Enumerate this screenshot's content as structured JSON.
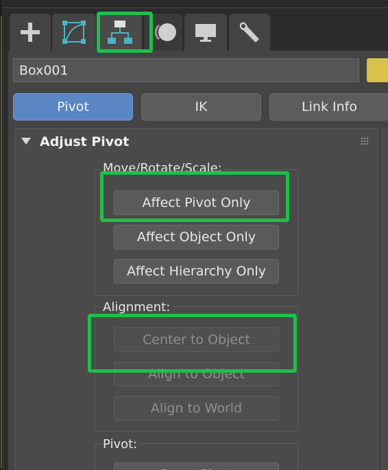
{
  "command_panel": {
    "tabs": [
      {
        "name": "create-tab",
        "icon": "plus-icon"
      },
      {
        "name": "modify-tab",
        "icon": "curve-modify-icon"
      },
      {
        "name": "hierarchy-tab",
        "icon": "hierarchy-icon",
        "active": true
      },
      {
        "name": "motion-tab",
        "icon": "motion-circle-icon"
      },
      {
        "name": "display-tab",
        "icon": "monitor-icon"
      },
      {
        "name": "utilities-tab",
        "icon": "wrench-icon"
      }
    ],
    "object_name": "Box001",
    "object_color": "#d9c14a"
  },
  "mode_buttons": {
    "pivot": "Pivot",
    "ik": "IK",
    "link_info": "Link Info"
  },
  "rollout": {
    "title": "Adjust Pivot",
    "move_group": {
      "label": "Move/Rotate/Scale:",
      "affect_pivot_only": "Affect Pivot Only",
      "affect_object_only": "Affect Object Only",
      "affect_hierarchy_only": "Affect Hierarchy Only"
    },
    "alignment_group": {
      "label": "Alignment:",
      "center_to_object": "Center to Object",
      "align_to_object": "Align to Object",
      "align_to_world": "Align to World"
    },
    "pivot_group": {
      "label": "Pivot:",
      "reset_pivot": "Reset Pivot"
    }
  },
  "colors": {
    "accent_active": "#5b86c4",
    "highlight": "#1fbf4a",
    "panel": "#444444"
  }
}
